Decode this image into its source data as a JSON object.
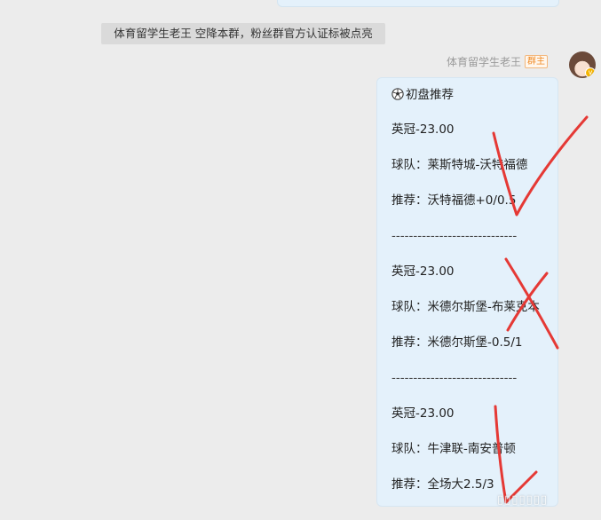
{
  "system_notice": "体育留学生老王 空降本群，粉丝群官方认证标被点亮",
  "message": {
    "sender_name": "体育留学生老王",
    "sender_role": "群主",
    "title_icon": "soccer-ball-icon",
    "title": "初盘推荐",
    "lines": [
      "英冠-23.00",
      "球队：莱斯特城-沃特福德",
      "推荐：沃特福德+0/0.5",
      "-----------------------------",
      "英冠-23.00",
      "球队：米德尔斯堡-布莱克本",
      "推荐：米德尔斯堡-0.5/1",
      "-----------------------------",
      "英冠-23.00",
      "球队：牛津联-南安普顿",
      "推荐：全场大2.5/3"
    ]
  },
  "annotations": {
    "color": "#e53935",
    "marks": [
      "check-mark",
      "cross-mark",
      "check-mark"
    ]
  },
  "colors": {
    "bubble_bg": "#e4f1fb",
    "page_bg": "#ececec",
    "badge": "#f08a24"
  }
}
